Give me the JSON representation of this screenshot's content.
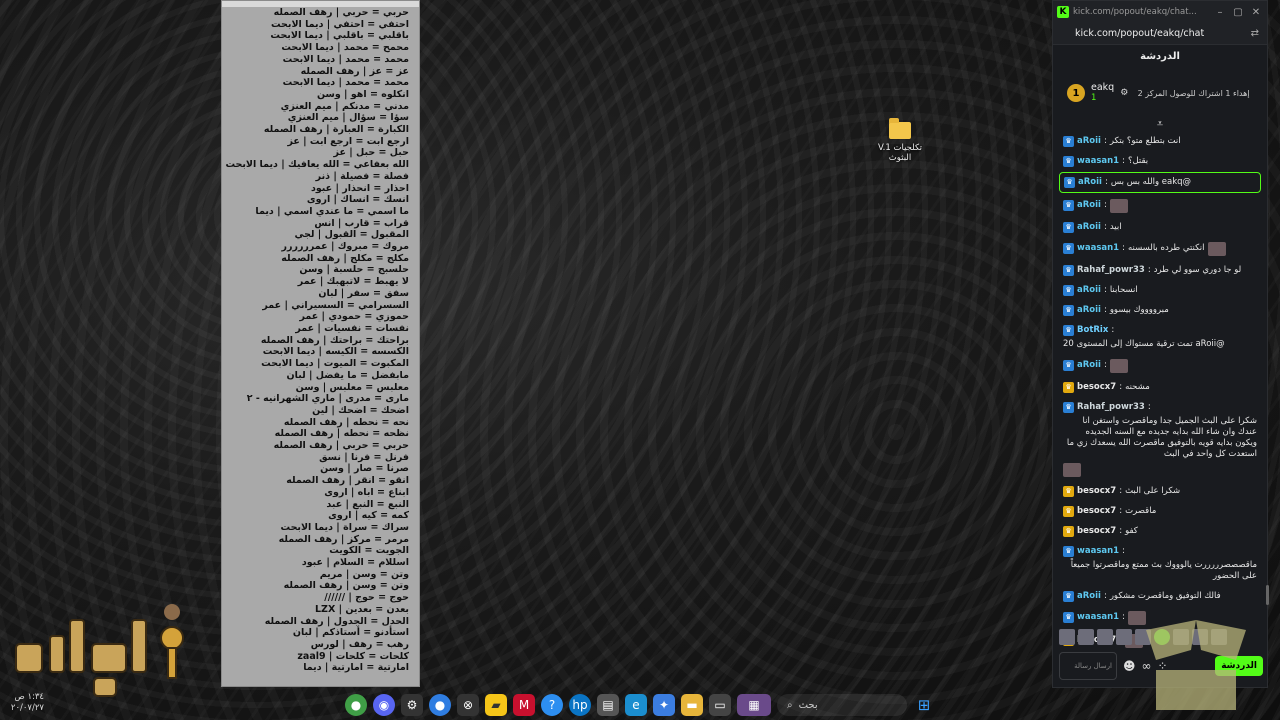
{
  "notepad": {
    "lines": [
      "حربي = حربي | رهف الصمله",
      "احتفي = احتفي | ديما الابحت",
      "باقلبي = باقلبي | ديما الابحت",
      "محمح = محمد | ديما الابحت",
      "محمد = محمد | ديما الابحت",
      "عز = عز | رهف الصمله",
      "محمد = محمد | ديما الابحت",
      "انكلوه = اهو | وسن",
      "مدني = مدنكم | ميم العنزي",
      "سؤا = سؤال | ميم العنزي",
      "الكبارة = العبارة | رهف الصمله",
      "ارجع ابت = ارجع ابت | عز",
      "حبل = حبل | عز",
      "الله بعفاعي = الله يعافيك | ديما الابحت",
      "فصلة = فصيلة | ذنر",
      "احذار = انحذار | عبود",
      "انسك = انساك | اروى",
      "ما اسمي = ما عندي اسمي | ديما",
      "قراب = قارب | انس",
      "المقبول = القبول | لجي",
      "مروك = مبروك | عمرررررر",
      "مكلج = مكلج | رهف الصمله",
      "حلسبج = حلسبة | وسن",
      "لا يهبط = لاتبهبك | عمر",
      "سفق = سفر | لبان",
      "السسرامي = السسيراني | عمر",
      "حموزي = حمودي | عمر",
      "نفسات = نفسيات | عمر",
      "براحتك = براحتك | رهف الصمله",
      "الكسسه = الكيسه | ديما الابحت",
      "المكبوت = الميوت | ديما الابحت",
      "مابفضل = ما يفضل | لبان",
      "معلبس = معلبس | وسن",
      "مارى = مدرى | ماري الشهرانيه - ٢",
      "اضحك = اضحك | لين",
      "نحه = نحطه | رهف الصمله",
      "نظحه = نحطه | رهف الصمله",
      "حربي = حربي | رهف الصمله",
      "فرنل = فرنا | نسق",
      "صرنا = صار | وسن",
      "انقو = انقر | رهف الصمله",
      "ابناع = اباه | اروى",
      "النبع = النبع | عبد",
      "كمه = كيه | اروى",
      "سراك = سراة | ديما الابحت",
      "مرمر = مركز | رهف الصمله",
      "الجويت = الكويت",
      "اسللام = السلام | عبود",
      "وتن = وسن | مريم",
      "وتن = وسن | رهف الصمله",
      "حوج = حوج | //////",
      "بعدن = بعدين | LZX",
      "الحدل = الجدول | رهف الصمله",
      "استأدنو = أستاذكم | لبان",
      "رهب = رهف | لورس",
      "كلحات = كلحات | zaal9",
      "امارتية = امارتية | ديما"
    ]
  },
  "desktop": {
    "folder_label": "تكلجيات V.1 البثوث"
  },
  "clock": {
    "time": "١:٣٤ ص",
    "date": "٢٠/٠٧/٢٧"
  },
  "taskbar": {
    "search_label": "بحث"
  },
  "chat_window": {
    "window_title": "kick.com/popout/eakq/chat...",
    "url": "kick.com/popout/eakq/chat",
    "header": "الدردشة",
    "goal": {
      "badge": "1",
      "username": "eakq",
      "count": "1",
      "description": "إهداء 1 اشتراك للوصول المركز 2"
    },
    "messages": [
      {
        "user": "aRoii",
        "color": "#5ec8f0",
        "role": "#2a7fd4",
        "text": "انت بتطلع متو؟ بتكر"
      },
      {
        "user": "waasan1",
        "color": "#5ec8f0",
        "role": "#2a7fd4",
        "text": "بقتل؟"
      },
      {
        "user": "aRoii",
        "color": "#5ec8f0",
        "role": "#2a7fd4",
        "text": "@eakq والله بس بس",
        "highlight": true
      },
      {
        "user": "aRoii",
        "color": "#5ec8f0",
        "role": "#2a7fd4",
        "text": "",
        "emote": true
      },
      {
        "user": "aRoii",
        "color": "#5ec8f0",
        "role": "#2a7fd4",
        "text": "ابيد"
      },
      {
        "user": "waasan1",
        "color": "#5ec8f0",
        "role": "#2a7fd4",
        "text": "انكنتي طرده بالسسنه",
        "emote": true
      },
      {
        "user": "Rahaf_powr33",
        "color": "#cfd8dc",
        "role": "#2a7fd4",
        "text": "لو جا دوري سوو لي طرد"
      },
      {
        "user": "aRoii",
        "color": "#5ec8f0",
        "role": "#2a7fd4",
        "text": "انسحابنا"
      },
      {
        "user": "aRoii",
        "color": "#5ec8f0",
        "role": "#2a7fd4",
        "text": "مبرووووك بيسوو"
      },
      {
        "user": "BotRix",
        "color": "#6fd0ff",
        "role": "#2a7fd4",
        "text": "@aRoii تمت ترقية مستواك إلى المستوى 20"
      },
      {
        "user": "aRoii",
        "color": "#5ec8f0",
        "role": "#2a7fd4",
        "text": "",
        "emote": true
      },
      {
        "user": "besocx7",
        "color": "#e8e8e8",
        "role": "#e2a90f",
        "text": "مشحنه"
      },
      {
        "user": "Rahaf_powr33",
        "color": "#cfd8dc",
        "role": "#2a7fd4",
        "text": "شكرا على البث الجميل جدا وماقصرت واستغن انا عندك وان شاء الله بدايه جديده مع السنه الجديده ويكون بدايه قويه بالتوفيق ماقصرت الله يسعدك زي ما استعدت كل واحد في البث",
        "emote": true
      },
      {
        "user": "besocx7",
        "color": "#e8e8e8",
        "role": "#e2a90f",
        "text": "شكرا على البث"
      },
      {
        "user": "besocx7",
        "color": "#e8e8e8",
        "role": "#e2a90f",
        "text": "ماقصرت"
      },
      {
        "user": "besocx7",
        "color": "#e8e8e8",
        "role": "#e2a90f",
        "text": "كفو"
      },
      {
        "user": "waasan1",
        "color": "#5ec8f0",
        "role": "#2a7fd4",
        "text": "ماقصصصرررررت يالوووك بث ممتع وماقصرتوا جميعاً على الحضور"
      },
      {
        "user": "aRoii",
        "color": "#5ec8f0",
        "role": "#2a7fd4",
        "text": "فالك التوفيق وماقصرت مشكور"
      },
      {
        "user": "waasan1",
        "color": "#5ec8f0",
        "role": "#2a7fd4",
        "text": "",
        "emote": true
      },
      {
        "user": "besocx7",
        "color": "#e8e8e8",
        "role": "#e2a90f",
        "text": "",
        "emote": true
      }
    ],
    "reply_hint": "وبالتوفيق ماقصرت الله يسعدك زي ما استعدت كل واحد في البث",
    "input_placeholder": "ارسال رسالة",
    "send_label": "الدردشة"
  }
}
